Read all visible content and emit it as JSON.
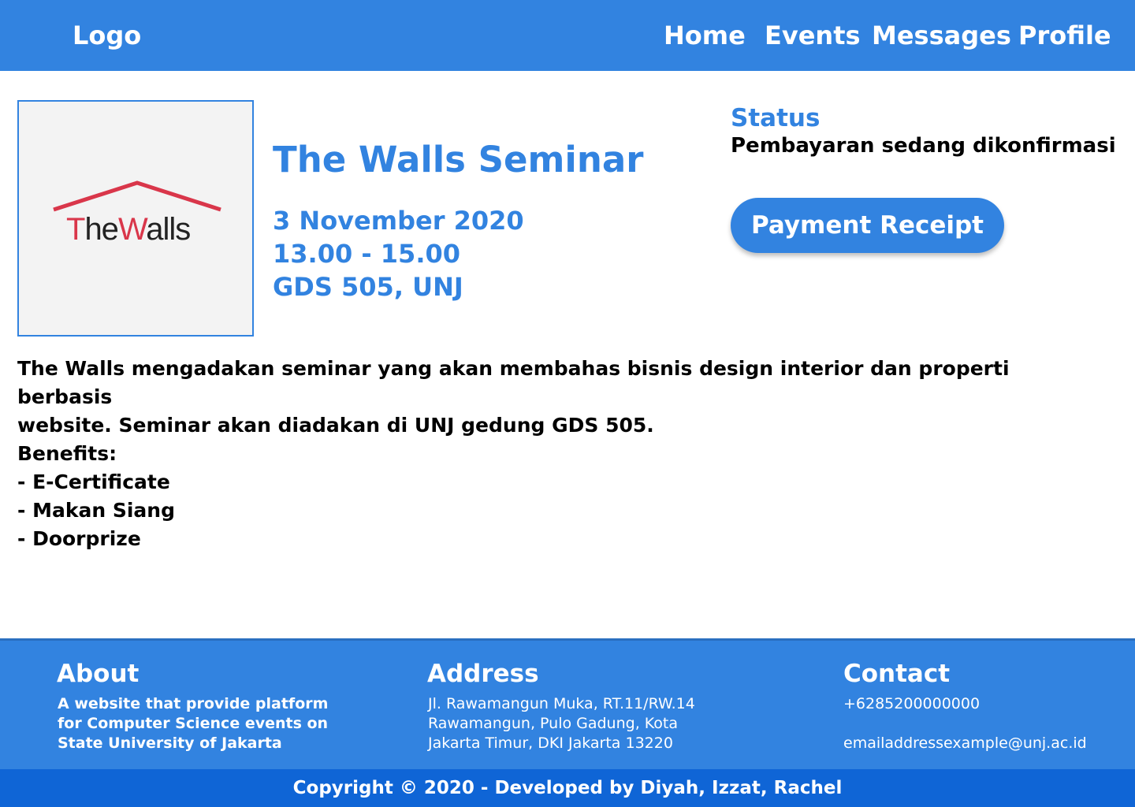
{
  "navbar": {
    "logo": "Logo",
    "items": [
      "Home",
      "Events",
      "Messages",
      "Profile"
    ]
  },
  "event": {
    "image_logo_text": "TheWalls",
    "title": "The Walls Seminar",
    "date": "3 November 2020",
    "time": "13.00 - 15.00",
    "venue": "GDS 505, UNJ",
    "description_lines": [
      "The Walls mengadakan seminar yang akan membahas bisnis design interior dan properti berbasis",
      "website. Seminar akan diadakan di UNJ gedung GDS 505."
    ],
    "benefits_title": "Benefits:",
    "benefits": [
      "- E-Certificate",
      "- Makan Siang",
      "- Doorprize"
    ]
  },
  "status": {
    "label": "Status",
    "value": "Pembayaran sedang dikonfirmasi",
    "button_label": "Payment Receipt"
  },
  "footer": {
    "about": {
      "title": "About",
      "lines": [
        "A website that provide platform",
        "for Computer Science events on",
        "State University of Jakarta"
      ]
    },
    "address": {
      "title": "Address",
      "lines": [
        "Jl. Rawamangun Muka, RT.11/RW.14",
        "Rawamangun, Pulo Gadung, Kota",
        "Jakarta Timur, DKI Jakarta 13220"
      ]
    },
    "contact": {
      "title": "Contact",
      "phone": "+6285200000000",
      "email": "emailaddressexample@unj.ac.id"
    },
    "copyright": "Copyright © 2020 - Developed by Diyah, Izzat, Rachel"
  },
  "colors": {
    "primary": "#3283e0",
    "copyright_bar": "#0f65d6",
    "logo_red": "#d9364a",
    "logo_dark": "#222222"
  }
}
